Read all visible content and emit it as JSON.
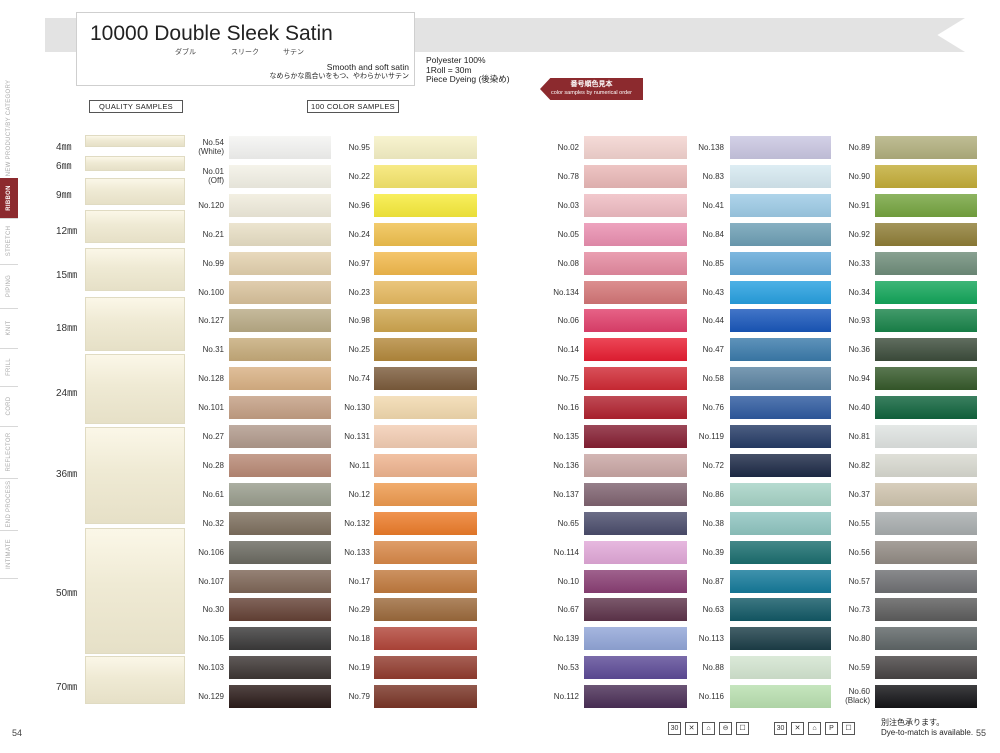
{
  "header": {
    "title": "10000  Double Sleek Satin",
    "kana": [
      "ダブル",
      "スリーク",
      "サテン"
    ],
    "subtitle_en": "Smooth and soft satin",
    "subtitle_jp": "なめらかな風合いをもつ、やわらかいサテン",
    "specs": [
      "Polyester 100%",
      "1Roll = 30m",
      "Piece Dyeing (後染め)"
    ]
  },
  "order_tag": {
    "jp": "番号順色見本",
    "en": "color samples by numerical order"
  },
  "sections": {
    "quality": "QUALITY SAMPLES",
    "colors": "100 COLOR SAMPLES"
  },
  "sidenav": {
    "items": [
      "NEW PRODUCT/BY CATEGORY",
      "RIBBON",
      "STRETCH",
      "PIPING",
      "KNIT",
      "FRILL",
      "CORD",
      "REFLECTOR",
      "END PROCESS",
      "INTIMATE"
    ],
    "active": "RIBBON"
  },
  "quality_samples": [
    {
      "label": "4㎜",
      "top": 0
    },
    {
      "label": "6㎜"
    },
    {
      "label": "9㎜"
    },
    {
      "label": "12㎜"
    },
    {
      "label": "15㎜"
    },
    {
      "label": "18㎜"
    },
    {
      "label": "24㎜"
    },
    {
      "label": "36㎜"
    },
    {
      "label": "50㎜"
    },
    {
      "label": "70㎜"
    }
  ],
  "color_columns": [
    [
      {
        "no": "No.54",
        "sub": "(White)",
        "color": "#f4f4f2"
      },
      {
        "no": "No.01",
        "sub": "(Off)",
        "color": "#f3f1e6"
      },
      {
        "no": "No.120",
        "color": "#f0ecdc"
      },
      {
        "no": "No.21",
        "color": "#e8dfc5"
      },
      {
        "no": "No.99",
        "color": "#e3d1ae"
      },
      {
        "no": "No.100",
        "color": "#d9c29c"
      },
      {
        "no": "No.127",
        "color": "#b9ab86"
      },
      {
        "no": "No.31",
        "color": "#c6ab7a"
      },
      {
        "no": "No.128",
        "color": "#d9b184"
      },
      {
        "no": "No.101",
        "color": "#c49f84"
      },
      {
        "no": "No.27",
        "color": "#b19a8c"
      },
      {
        "no": "No.28",
        "color": "#b88975"
      },
      {
        "no": "No.61",
        "color": "#999d8d"
      },
      {
        "no": "No.32",
        "color": "#7d6f5e"
      },
      {
        "no": "No.106",
        "color": "#6b6a61"
      },
      {
        "no": "No.107",
        "color": "#7e6657"
      },
      {
        "no": "No.30",
        "color": "#654236"
      },
      {
        "no": "No.105",
        "color": "#3b3a3a"
      },
      {
        "no": "No.103",
        "color": "#3d3634"
      },
      {
        "no": "No.129",
        "color": "#2c1c1a"
      }
    ],
    [
      {
        "no": "No.95",
        "color": "#f6f1c5"
      },
      {
        "no": "No.22",
        "color": "#f6e66c"
      },
      {
        "no": "No.96",
        "color": "#f7eb3b"
      },
      {
        "no": "No.24",
        "color": "#f0c04d"
      },
      {
        "no": "No.97",
        "color": "#f2b94c"
      },
      {
        "no": "No.23",
        "color": "#e6b960"
      },
      {
        "no": "No.98",
        "color": "#cfa64f"
      },
      {
        "no": "No.25",
        "color": "#b4893c"
      },
      {
        "no": "No.74",
        "color": "#7c5c3c"
      },
      {
        "no": "No.130",
        "color": "#f2d9ae"
      },
      {
        "no": "No.131",
        "color": "#f3cdb3"
      },
      {
        "no": "No.11",
        "color": "#efb48f"
      },
      {
        "no": "No.12",
        "color": "#ee9a4e"
      },
      {
        "no": "No.132",
        "color": "#ec7c2a"
      },
      {
        "no": "No.133",
        "color": "#d88848"
      },
      {
        "no": "No.17",
        "color": "#c17a3e"
      },
      {
        "no": "No.29",
        "color": "#9c6a3c"
      },
      {
        "no": "No.18",
        "color": "#b2463a"
      },
      {
        "no": "No.19",
        "color": "#923c2f"
      },
      {
        "no": "No.79",
        "color": "#7a3527"
      }
    ],
    [
      {
        "no": "No.02",
        "color": "#f3d3cf"
      },
      {
        "no": "No.78",
        "color": "#eab8b7"
      },
      {
        "no": "No.03",
        "color": "#efbcc2"
      },
      {
        "no": "No.05",
        "color": "#ea8fb0"
      },
      {
        "no": "No.08",
        "color": "#e58aa0"
      },
      {
        "no": "No.134",
        "color": "#d47677"
      },
      {
        "no": "No.06",
        "color": "#e1406c"
      },
      {
        "no": "No.14",
        "color": "#e81e32"
      },
      {
        "no": "No.75",
        "color": "#d02a35"
      },
      {
        "no": "No.16",
        "color": "#b1222f"
      },
      {
        "no": "No.135",
        "color": "#861f33"
      },
      {
        "no": "No.136",
        "color": "#c9a6a4"
      },
      {
        "no": "No.137",
        "color": "#7f6370"
      },
      {
        "no": "No.65",
        "color": "#4b4d6c"
      },
      {
        "no": "No.114",
        "color": "#e1a8d8"
      },
      {
        "no": "No.10",
        "color": "#8a3f74"
      },
      {
        "no": "No.67",
        "color": "#5e344b"
      },
      {
        "no": "No.139",
        "color": "#92a6d8"
      },
      {
        "no": "No.53",
        "color": "#5d4b97"
      },
      {
        "no": "No.112",
        "color": "#4b2f57"
      }
    ],
    [
      {
        "no": "No.138",
        "color": "#c9c6e1"
      },
      {
        "no": "No.83",
        "color": "#d6e9f1"
      },
      {
        "no": "No.41",
        "color": "#9dcbe6"
      },
      {
        "no": "No.84",
        "color": "#6d9fb5"
      },
      {
        "no": "No.85",
        "color": "#61a8d8"
      },
      {
        "no": "No.43",
        "color": "#27a0e0"
      },
      {
        "no": "No.44",
        "color": "#1957bb"
      },
      {
        "no": "No.47",
        "color": "#3b7bab"
      },
      {
        "no": "No.58",
        "color": "#5c84a2"
      },
      {
        "no": "No.76",
        "color": "#2e5a9f"
      },
      {
        "no": "No.119",
        "color": "#253b66"
      },
      {
        "no": "No.72",
        "color": "#1d2a47"
      },
      {
        "no": "No.86",
        "color": "#a6d3c6"
      },
      {
        "no": "No.38",
        "color": "#8fc5c0"
      },
      {
        "no": "No.39",
        "color": "#1b6e6f"
      },
      {
        "no": "No.87",
        "color": "#157a9a"
      },
      {
        "no": "No.63",
        "color": "#125966"
      },
      {
        "no": "No.113",
        "color": "#1c3e48"
      },
      {
        "no": "No.88",
        "color": "#d3e5d0"
      },
      {
        "no": "No.116",
        "color": "#b9e0b0"
      }
    ],
    [
      {
        "no": "No.89",
        "color": "#b1af7d"
      },
      {
        "no": "No.90",
        "color": "#c3ad38"
      },
      {
        "no": "No.91",
        "color": "#75a43f"
      },
      {
        "no": "No.92",
        "color": "#8f7e37"
      },
      {
        "no": "No.33",
        "color": "#6f8d7a"
      },
      {
        "no": "No.34",
        "color": "#13a65a"
      },
      {
        "no": "No.93",
        "color": "#19844a"
      },
      {
        "no": "No.36",
        "color": "#3d4d3c"
      },
      {
        "no": "No.94",
        "color": "#365a2b"
      },
      {
        "no": "No.40",
        "color": "#10643d"
      },
      {
        "no": "No.81",
        "color": "#dfe3e1"
      },
      {
        "no": "No.82",
        "color": "#d8d9d0"
      },
      {
        "no": "No.37",
        "color": "#cfc4ae"
      },
      {
        "no": "No.55",
        "color": "#a8adae"
      },
      {
        "no": "No.56",
        "color": "#928b84"
      },
      {
        "no": "No.57",
        "color": "#6f7073"
      },
      {
        "no": "No.73",
        "color": "#5d5d5d"
      },
      {
        "no": "No.80",
        "color": "#5f6667"
      },
      {
        "no": "No.59",
        "color": "#484444"
      },
      {
        "no": "No.60",
        "sub": "(Black)",
        "color": "#141417"
      }
    ]
  ],
  "footer": {
    "page_left": "54",
    "page_right": "55",
    "note_jp": "別注色承ります。",
    "note_en": "Dye-to-match is available.",
    "care_icons_left": [
      "30",
      "✕",
      "⌂",
      "⊖",
      "☐"
    ],
    "care_icons_right": [
      "30",
      "✕",
      "⌂",
      "P",
      "☐"
    ]
  }
}
